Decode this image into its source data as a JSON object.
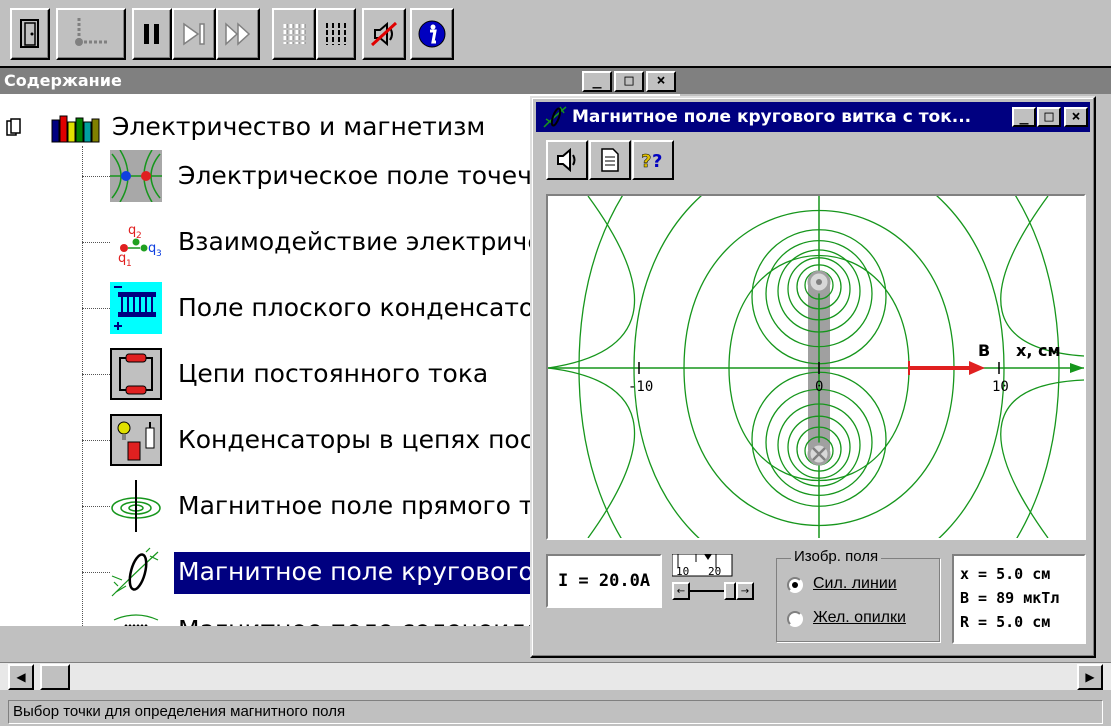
{
  "toolbar": {
    "buttons": [
      "exit-icon",
      "dotted-icon",
      "pause-icon",
      "step-icon",
      "fast-forward-icon",
      "step-bars-icon",
      "bars-icon",
      "sound-off-icon",
      "info-icon"
    ]
  },
  "contents": {
    "title": "Содержание",
    "root_label": "Электричество и магнетизм",
    "items": [
      {
        "label": "Электрическое поле точечнь",
        "icon": "electric-field-icon"
      },
      {
        "label": "Взаимодействие электричес",
        "icon": "charges-interaction-icon"
      },
      {
        "label": "Поле плоского конденсатора",
        "icon": "capacitor-icon"
      },
      {
        "label": "Цепи постоянного тока",
        "icon": "dc-circuit-icon"
      },
      {
        "label": "Конденсаторы в цепях посто",
        "icon": "capacitor-circuit-icon"
      },
      {
        "label": "Магнитное поле прямого ток",
        "icon": "straight-current-icon"
      },
      {
        "label": "Магнитное поле кругового ві",
        "icon": "circular-loop-icon"
      },
      {
        "label": "Магнитное поле соленоида",
        "icon": "solenoid-icon"
      }
    ],
    "selected_index": 6
  },
  "sim": {
    "title": "Магнитное поле кругового витка с ток...",
    "tools": [
      "speaker-icon",
      "document-icon",
      "help-icon"
    ],
    "plot": {
      "axis_label_b": "B",
      "axis_label_x": "x, см",
      "ticks": [
        "-10",
        "0",
        "10"
      ]
    },
    "current_text": "I = 20.0A",
    "scale_labels": [
      "10",
      "20"
    ],
    "field_group_title": "Изобр. поля",
    "radio_lines": "Сил. линии",
    "radio_filings": "Жел. опилки",
    "readout": {
      "x": "x  = 5.0 см",
      "b": "B  = 89 мкТл",
      "r": "R  = 5.0 см"
    }
  },
  "status": "Выбор точки для определения магнитного поля",
  "colors": {
    "field_lines": "#16961c",
    "vector": "#e02020",
    "title_active": "#000080",
    "title_inactive": "#808080"
  }
}
